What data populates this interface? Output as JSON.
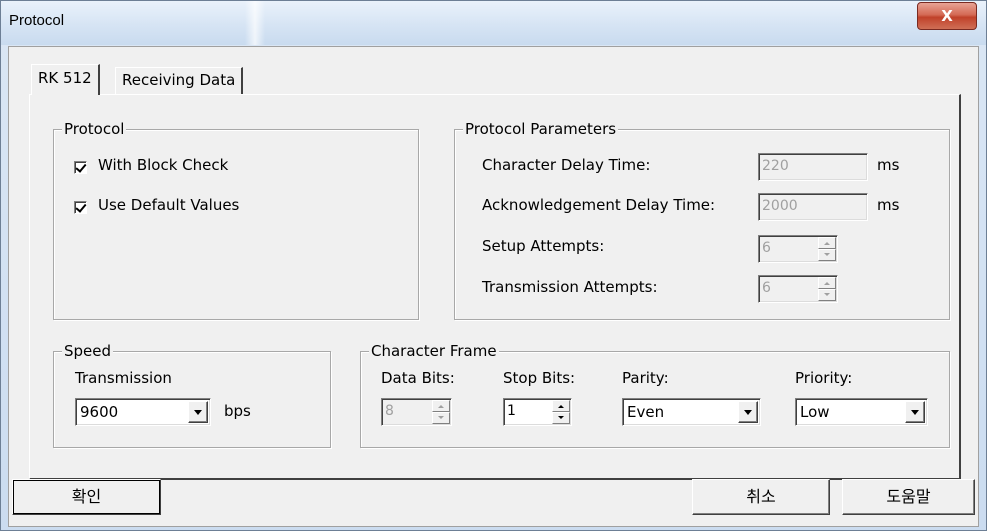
{
  "window": {
    "title": "Protocol",
    "close_label": "X"
  },
  "tabs": [
    {
      "label": "RK 512",
      "active": true
    },
    {
      "label": "Receiving Data",
      "active": false
    }
  ],
  "protocol_group": {
    "legend": "Protocol",
    "block_check": {
      "label": "With Block Check",
      "checked": true
    },
    "default_values": {
      "label": "Use Default Values",
      "checked": true
    }
  },
  "params_group": {
    "legend": "Protocol Parameters",
    "char_delay": {
      "label": "Character Delay Time:",
      "value": "220",
      "unit": "ms"
    },
    "ack_delay": {
      "label": "Acknowledgement Delay Time:",
      "value": "2000",
      "unit": "ms"
    },
    "setup_attempts": {
      "label": "Setup Attempts:",
      "value": "6"
    },
    "transmission_attempts": {
      "label": "Transmission Attempts:",
      "value": "6"
    }
  },
  "speed_group": {
    "legend": "Speed",
    "transmission_label": "Transmission",
    "rate": "9600",
    "unit": "bps"
  },
  "frame_group": {
    "legend": "Character Frame",
    "data_bits": {
      "label": "Data Bits:",
      "value": "8"
    },
    "stop_bits": {
      "label": "Stop Bits:",
      "value": "1"
    },
    "parity": {
      "label": "Parity:",
      "value": "Even"
    },
    "priority": {
      "label": "Priority:",
      "value": "Low"
    }
  },
  "buttons": {
    "ok": "확인",
    "cancel": "취소",
    "help": "도움말"
  }
}
